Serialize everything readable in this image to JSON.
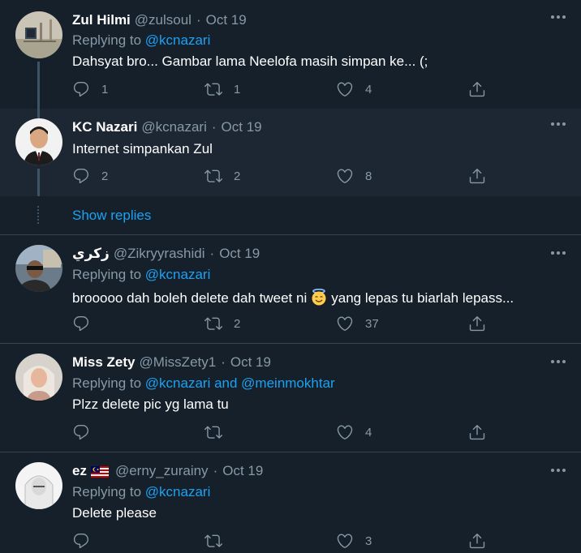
{
  "tweets": [
    {
      "name": "Zul Hilmi",
      "handle": "@zulsoul",
      "date": "Oct 19",
      "replying_label": "Replying to",
      "replying_to": "@kcnazari",
      "text": "Dahsyat bro... Gambar lama Neelofa masih simpan ke... (;",
      "replies": "1",
      "retweets": "1",
      "likes": "4"
    },
    {
      "name": "KC Nazari",
      "handle": "@kcnazari",
      "date": "Oct 19",
      "text": "Internet simpankan Zul",
      "replies": "2",
      "retweets": "2",
      "likes": "8"
    },
    {
      "name": "زكري",
      "handle": "@Zikryyrashidi",
      "date": "Oct 19",
      "replying_label": "Replying to",
      "replying_to": "@kcnazari",
      "text_before": "brooooo dah boleh delete dah tweet ni",
      "text_after": "yang lepas tu biarlah lepass...",
      "retweets": "2",
      "likes": "37"
    },
    {
      "name": "Miss Zety",
      "handle": "@MissZety1",
      "date": "Oct 19",
      "replying_label": "Replying to",
      "replying_to": "@kcnazari and @meinmokhtar",
      "text": "Plzz delete pic yg lama tu",
      "likes": "4"
    },
    {
      "name": "ez",
      "handle": "@erny_zurainy",
      "date": "Oct 19",
      "replying_label": "Replying to",
      "replying_to": "@kcnazari",
      "text": "Delete please",
      "likes": "3"
    }
  ],
  "show_replies": "Show replies",
  "colors": {
    "background": "#15202b",
    "highlight": "#1c2733",
    "link": "#1da1f2",
    "muted": "#8899a6",
    "divider": "#38444d"
  },
  "icons": [
    "more-icon",
    "reply-icon",
    "retweet-icon",
    "like-icon",
    "share-icon",
    "smiling-halo-emoji",
    "malaysia-flag-icon"
  ]
}
